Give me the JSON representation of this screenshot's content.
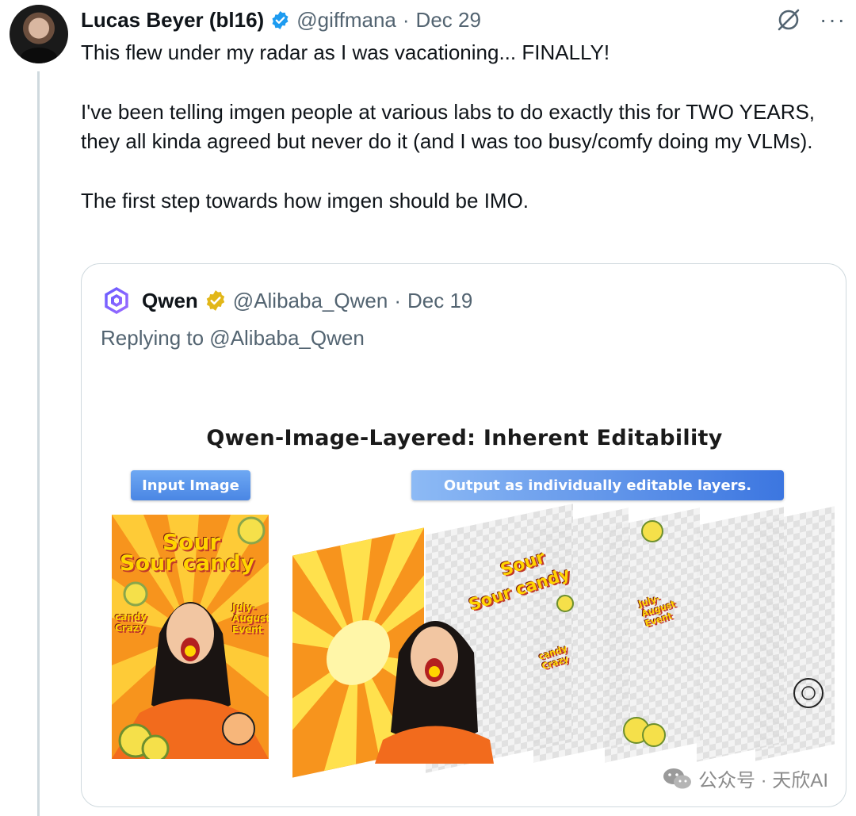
{
  "tweet": {
    "author_name": "Lucas Beyer (bl16)",
    "handle": "@giffmana",
    "separator": "·",
    "date": "Dec 29",
    "more_label": "···",
    "paragraphs": [
      "This flew under my radar as I was vacationing... FINALLY!",
      "I've been telling imgen people at various labs to do exactly this for TWO YEARS, they all kinda agreed but never do it (and I was too busy/comfy doing my VLMs).",
      "The first step towards how imgen should be IMO."
    ]
  },
  "quote": {
    "author_name": "Qwen",
    "handle": "@Alibaba_Qwen",
    "separator": "·",
    "date": "Dec 19",
    "replying_to": "Replying to @Alibaba_Qwen"
  },
  "figure": {
    "title": "Qwen-Image-Layered: Inherent Editability",
    "input_label": "Input Image",
    "output_label": "Output as individually editable layers.",
    "poster_word1": "Sour",
    "poster_word2": "Sour candy",
    "poster_side1": "candy Crazy",
    "poster_side2": "July-August Event",
    "layer_word1": "Sour",
    "layer_word2": "Sour candy",
    "layer_side1": "candy Crazy",
    "layer_side2": "July-August Event"
  },
  "watermark": {
    "text": "公众号 · 天欣AI"
  },
  "colors": {
    "verified_blue": "#1d9bf0",
    "gold_badge": "#e2b719",
    "thread_line": "#cfd9de",
    "secondary_text": "#536471"
  }
}
